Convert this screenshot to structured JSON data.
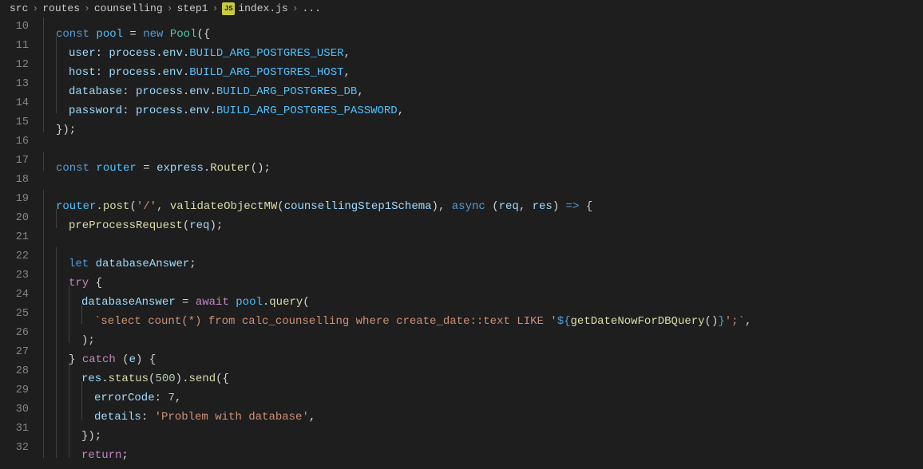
{
  "breadcrumb": {
    "items": [
      "src",
      "routes",
      "counselling",
      "step1"
    ],
    "file": "index.js",
    "suffix": "..."
  },
  "gutter": {
    "start": 10,
    "end": 32
  },
  "code": {
    "l10": {
      "const": "const",
      "pool": "pool",
      "eq": " = ",
      "new": "new",
      "Pool": "Pool",
      "open": "({"
    },
    "l11": {
      "user": "user",
      "col": ": ",
      "process": "process",
      "dot": ".",
      "env": "env",
      "dot2": ".",
      "envvar": "BUILD_ARG_POSTGRES_USER",
      "comma": ","
    },
    "l12": {
      "host": "host",
      "col": ": ",
      "process": "process",
      "dot": ".",
      "env": "env",
      "dot2": ".",
      "envvar": "BUILD_ARG_POSTGRES_HOST",
      "comma": ","
    },
    "l13": {
      "database": "database",
      "col": ": ",
      "process": "process",
      "dot": ".",
      "env": "env",
      "dot2": ".",
      "envvar": "BUILD_ARG_POSTGRES_DB",
      "comma": ","
    },
    "l14": {
      "password": "password",
      "col": ": ",
      "process": "process",
      "dot": ".",
      "env": "env",
      "dot2": ".",
      "envvar": "BUILD_ARG_POSTGRES_PASSWORD",
      "comma": ","
    },
    "l15": {
      "close": "});"
    },
    "l17": {
      "const": "const",
      "router": "router",
      "eq": " = ",
      "express": "express",
      "dot": ".",
      "Router": "Router",
      "par": "();"
    },
    "l19": {
      "router": "router",
      "dot": ".",
      "post": "post",
      "open": "(",
      "path": "'/'",
      "c1": ", ",
      "validate": "validateObjectMW",
      "open2": "(",
      "schema": "counsellingStep1Schema",
      "close2": ")",
      "c2": ", ",
      "async": "async",
      "sp": " ",
      "open3": "(",
      "req": "req",
      "c3": ", ",
      "res": "res",
      "close3": ")",
      "arrow": " => ",
      "brace": "{"
    },
    "l20": {
      "fn": "preProcessRequest",
      "open": "(",
      "req": "req",
      "close": ");"
    },
    "l22": {
      "let": "let",
      "var": "databaseAnswer",
      "semi": ";"
    },
    "l23": {
      "try": "try",
      "brace": " {"
    },
    "l24": {
      "var": "databaseAnswer",
      "eq": " = ",
      "await": "await",
      "sp": " ",
      "pool": "pool",
      "dot": ".",
      "query": "query",
      "open": "("
    },
    "l25": {
      "bt": "`",
      "sql": "select count(*) from calc_counselling where create_date::text LIKE '",
      "tpl_open": "${",
      "fn": "getDateNowForDBQuery",
      "par": "()",
      "tpl_close": "}",
      "sql2": "';",
      "bt2": "`",
      "comma": ","
    },
    "l26": {
      "close": ");"
    },
    "l27": {
      "close": "}",
      "sp": " ",
      "catch": "catch",
      "sp2": " (",
      "e": "e",
      "close2": ") {"
    },
    "l28": {
      "res": "res",
      "dot": ".",
      "status": "status",
      "open": "(",
      "code": "500",
      "close": ").",
      "send": "send",
      "open2": "({"
    },
    "l29": {
      "key": "errorCode",
      "col": ": ",
      "val": "7",
      "comma": ","
    },
    "l30": {
      "key": "details",
      "col": ": ",
      "val": "'Problem with database'",
      "comma": ","
    },
    "l31": {
      "close": "});"
    },
    "l32": {
      "return": "return",
      "semi": ";"
    }
  }
}
